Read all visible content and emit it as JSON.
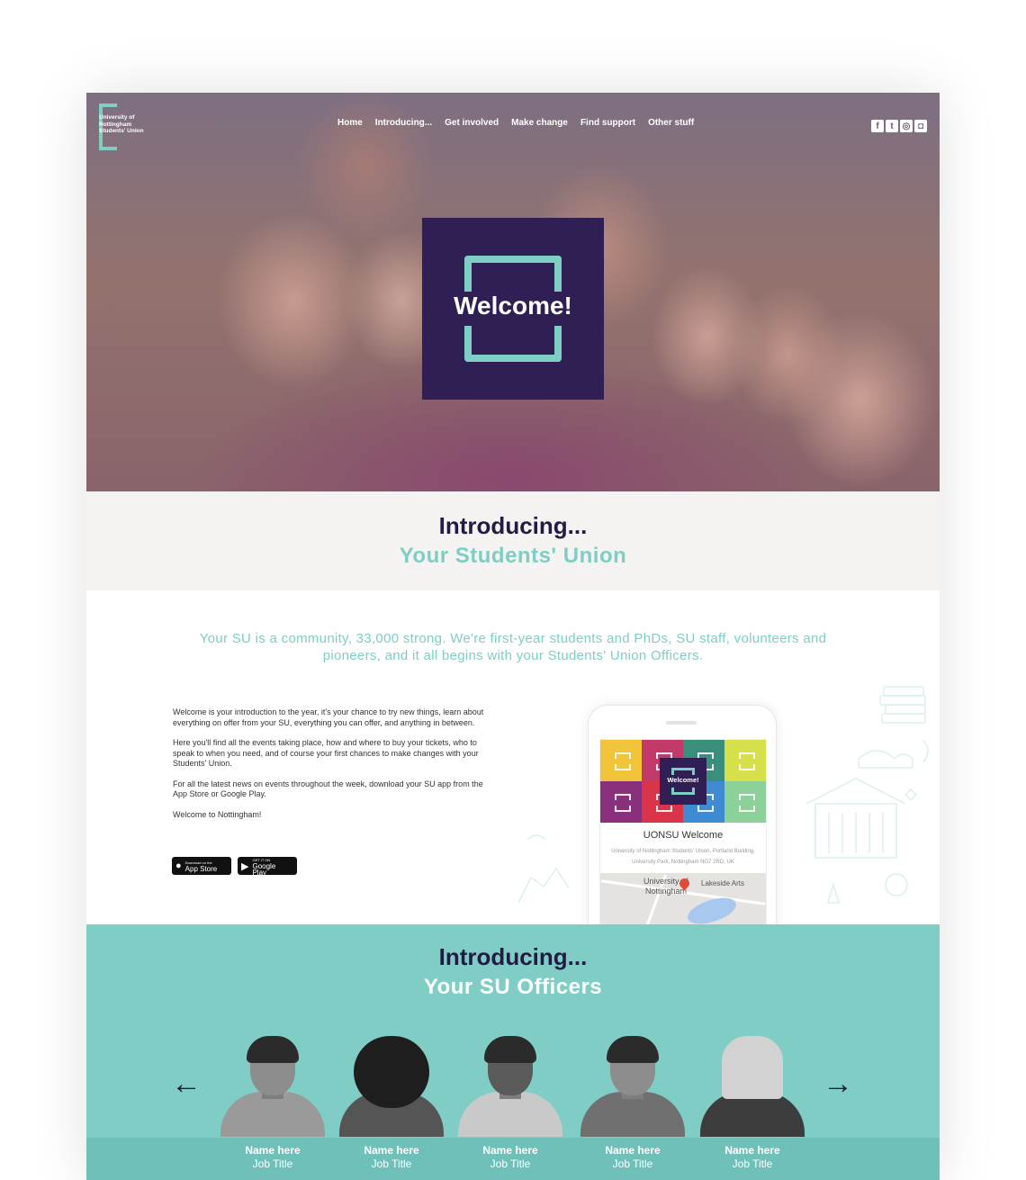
{
  "logo": {
    "text": "University of Nottingham Students' Union"
  },
  "nav": {
    "items": [
      "Home",
      "Introducing...",
      "Get involved",
      "Make change",
      "Find support",
      "Other stuff"
    ]
  },
  "social": {
    "icons": [
      "facebook-icon",
      "twitter-icon",
      "instagram-icon",
      "snapchat-icon"
    ],
    "glyphs": [
      "f",
      "t",
      "◎",
      "◘"
    ]
  },
  "hero": {
    "welcome": "Welcome!"
  },
  "intro": {
    "title": "Introducing...",
    "subtitle": "Your Students' Union"
  },
  "lead": "Your SU is a community, 33,000 strong. We're first-year students and PhDs, SU staff, volunteers and pioneers, and it all begins with your Students' Union Officers.",
  "body": {
    "p1": "Welcome is your introduction to the year, it's your chance to try new things, learn about everything on offer from your SU, everything you can offer, and anything in between.",
    "p2": "Here you'll find all the events taking place, how and where to buy your tickets, who to speak to when you need, and of course your first chances to make changes with your Students' Union.",
    "p3": "For all the latest news on events throughout the week, download your SU app from the App Store or Google Play.",
    "p4": "Welcome to Nottingham!"
  },
  "stores": {
    "apple_small": "Download on the",
    "apple": "App Store",
    "google_small": "GET IT ON",
    "google": "Google Play"
  },
  "phone": {
    "welcome": "Welcome!",
    "title": "UONSU Welcome",
    "address": "University of Nottingham Students' Union, Portland Building, University Park, Nottingham NG7 2RD, UK",
    "map_label_1": "University of",
    "map_label_2": "Nottingham",
    "map_label_3": "Lakeside Arts",
    "tile_colors": [
      "#f2c43a",
      "#c23a6a",
      "#3a8f7c",
      "#d5e04a",
      "#8a2f7c",
      "#d9344a",
      "#3f8bd2",
      "#8dd19a"
    ]
  },
  "officers": {
    "title": "Introducing...",
    "subtitle": "Your SU Officers",
    "prev": "←",
    "next": "→",
    "list": [
      {
        "name": "Name here",
        "job": "Job Title"
      },
      {
        "name": "Name here",
        "job": "Job Title"
      },
      {
        "name": "Name here",
        "job": "Job Title"
      },
      {
        "name": "Name here",
        "job": "Job Title"
      },
      {
        "name": "Name here",
        "job": "Job Title"
      }
    ]
  },
  "colors": {
    "accent": "#7ecec4",
    "navy": "#2f1f55",
    "officers_bg": "#7fcdc5"
  }
}
